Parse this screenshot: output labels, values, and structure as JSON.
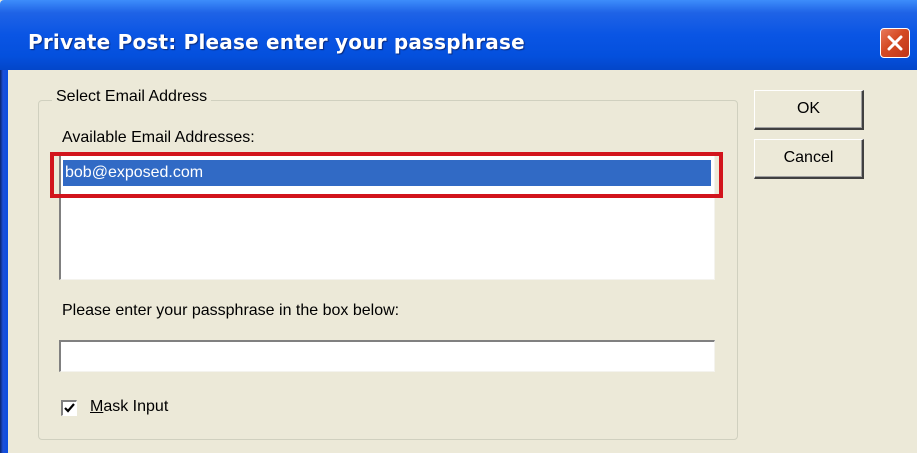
{
  "window": {
    "title": "Private Post: Please enter your passphrase"
  },
  "group": {
    "legend": "Select Email Address",
    "list_label": "Available Email Addresses:",
    "addresses": [
      {
        "email": "bob@exposed.com",
        "selected": true
      }
    ]
  },
  "passphrase": {
    "label": "Please enter your passphrase in the box below:",
    "value": ""
  },
  "mask_input": {
    "mnemonic": "M",
    "label_rest": "ask Input",
    "checked": true
  },
  "buttons": {
    "ok": "OK",
    "cancel": "Cancel"
  },
  "colors": {
    "titlebar": "#0450dd",
    "selection": "#316ac5",
    "highlight_annotation": "#d2141c",
    "close_button": "#d44a22"
  },
  "icons": {
    "close": "close-icon",
    "check": "checkmark-icon"
  }
}
